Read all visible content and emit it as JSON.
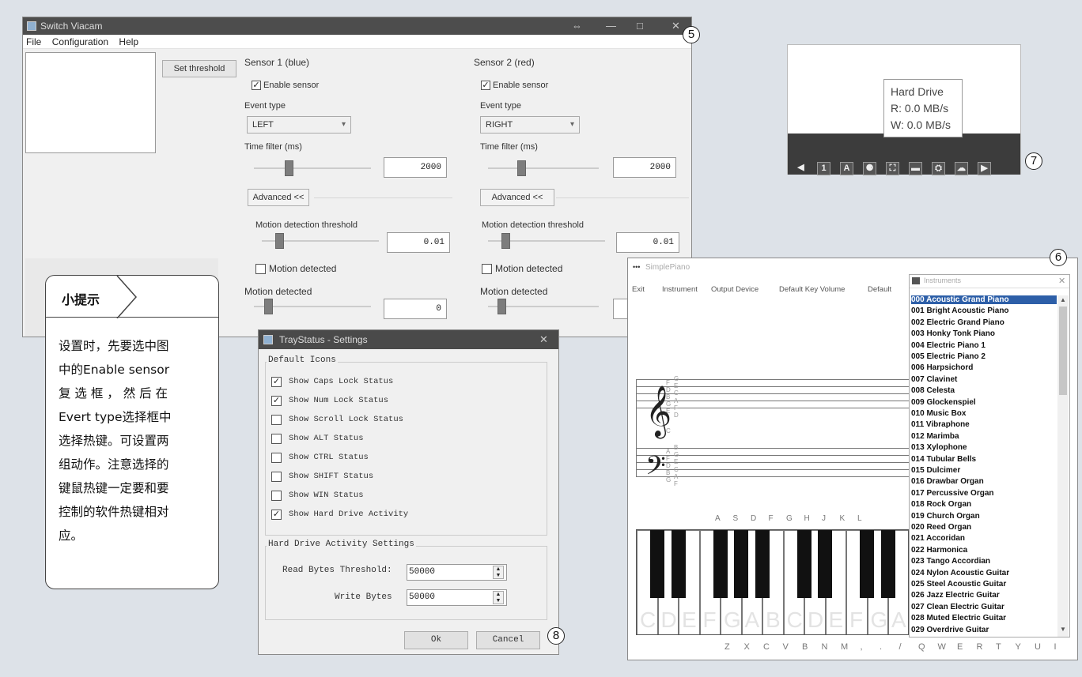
{
  "viacam": {
    "title": "Switch Viacam",
    "title_controls": [
      "⇔",
      "—",
      "□",
      "✕"
    ],
    "menu": [
      "File",
      "Configuration",
      "Help"
    ],
    "set_threshold": "Set threshold",
    "sensors": [
      {
        "title": "Sensor 1 (blue)",
        "enable": "Enable sensor",
        "event_type_label": "Event type",
        "event_type": "LEFT",
        "time_filter_label": "Time filter (ms)",
        "time_filter": "2000",
        "advanced": "Advanced <<",
        "motion_threshold_label": "Motion detection threshold",
        "motion_threshold": "0.01",
        "motion_detected_check": "Motion detected",
        "motion_detected_label": "Motion detected",
        "motion_value": "0",
        "time_level": 0.3,
        "threshold_level": 0.15,
        "motion_level": 0.12
      },
      {
        "title": "Sensor 2 (red)",
        "enable": "Enable sensor",
        "event_type_label": "Event type",
        "event_type": "RIGHT",
        "time_filter_label": "Time filter (ms)",
        "time_filter": "2000",
        "advanced": "Advanced <<",
        "motion_threshold_label": "Motion detection threshold",
        "motion_threshold": "0.01",
        "motion_detected_check": "Motion detected",
        "motion_detected_label": "Motion detected",
        "motion_value": "",
        "time_level": 0.3,
        "threshold_level": 0.15,
        "motion_level": 0.12
      }
    ]
  },
  "callouts": {
    "c5": "5",
    "c6": "6",
    "c7": "7",
    "c8": "8"
  },
  "tip": {
    "title": "小提示",
    "lines": [
      "设置时，先要选中图",
      "中的Enable sensor",
      "复 选 框 ， 然 后 在",
      "Evert type选择框中",
      "选择热键。可设置两",
      "组动作。注意选择的",
      "键鼠热键一定要和要",
      "控制的软件热键相对",
      "应。"
    ]
  },
  "tray": {
    "tooltip_title": "Hard Drive",
    "tooltip_read": "R: 0.0 MB/s",
    "tooltip_write": "W: 0.0 MB/s",
    "icons": [
      "speaker-icon",
      "num-lock-icon",
      "caps-lock-icon",
      "hard-drive-icon",
      "network-icon",
      "chat-icon",
      "settings-icon",
      "cloud-icon",
      "terminal-icon"
    ],
    "icon_glyphs": [
      "◀",
      "1",
      "A",
      "⚈",
      "⛶",
      "▬",
      "⛭",
      "☁",
      "▶"
    ]
  },
  "traystatus": {
    "title": "TrayStatus - Settings",
    "group_default": "Default Icons",
    "options": [
      {
        "label": "Show Caps Lock Status",
        "checked": true
      },
      {
        "label": "Show Num Lock Status",
        "checked": true
      },
      {
        "label": "Show Scroll Lock Status",
        "checked": false
      },
      {
        "label": "Show ALT Status",
        "checked": false
      },
      {
        "label": "Show CTRL Status",
        "checked": false
      },
      {
        "label": "Show SHIFT Status",
        "checked": false
      },
      {
        "label": "Show WIN Status",
        "checked": false
      },
      {
        "label": "Show Hard Drive Activity",
        "checked": true
      }
    ],
    "group_hd": "Hard Drive Activity Settings",
    "read_label": "Read Bytes Threshold:",
    "read_value": "50000",
    "write_label": "Write Bytes",
    "write_value": "50000",
    "ok": "Ok",
    "cancel": "Cancel"
  },
  "piano": {
    "title": "SimplePiano",
    "menu": [
      "Exit",
      "Instrument",
      "Output Device",
      "Default Key Volume",
      "Default"
    ],
    "treble_notes": [
      "G",
      "F",
      "E",
      "D",
      "C",
      "B",
      "A",
      "G",
      "F",
      "E",
      "D"
    ],
    "middle_c": "C",
    "bass_notes": [
      "B",
      "A",
      "G",
      "F",
      "E",
      "D",
      "C",
      "B",
      "A",
      "G",
      "F"
    ],
    "upper_keys": [
      "A",
      "S",
      "D",
      "F",
      "G",
      "H",
      "J",
      "K",
      "L"
    ],
    "white_labels": [
      "C",
      "D",
      "E",
      "F",
      "G",
      "A",
      "B",
      "C",
      "D",
      "E",
      "F",
      "G",
      "A"
    ],
    "lower_keys": [
      "Z",
      "X",
      "C",
      "V",
      "B",
      "N",
      "M",
      ",",
      ".",
      "/",
      "Q",
      "W",
      "E",
      "R",
      "T",
      "Y",
      "U",
      "I"
    ],
    "instruments_title": "Instruments",
    "instruments": [
      "000 Acoustic Grand Piano",
      "001 Bright Acoustic Piano",
      "002 Electric Grand Piano",
      "003 Honky Tonk Piano",
      "004 Electric Piano 1",
      "005 Electric Piano 2",
      "006 Harpsichord",
      "007 Clavinet",
      "008 Celesta",
      "009 Glockenspiel",
      "010 Music Box",
      "011 Vibraphone",
      "012 Marimba",
      "013 Xylophone",
      "014 Tubular Bells",
      "015 Dulcimer",
      "016 Drawbar Organ",
      "017 Percussive Organ",
      "018 Rock Organ",
      "019 Church Organ",
      "020 Reed Organ",
      "021 Accoridan",
      "022 Harmonica",
      "023 Tango Accordian",
      "024 Nylon Acoustic Guitar",
      "025 Steel Acoustic Guitar",
      "026 Jazz Electric Guitar",
      "027 Clean Electric Guitar",
      "028 Muted Electric Guitar",
      "029 Overdrive Guitar"
    ]
  }
}
